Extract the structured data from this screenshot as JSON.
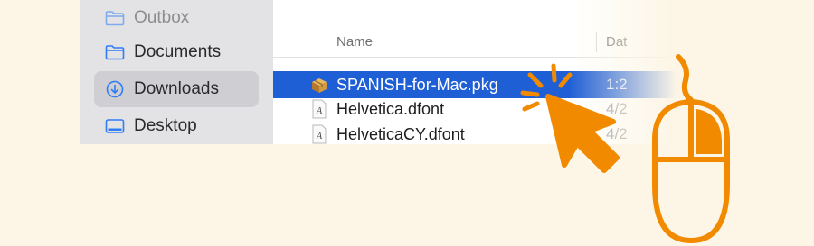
{
  "sidebar": {
    "items": [
      {
        "label": "Outbox",
        "icon": "folder-icon"
      },
      {
        "label": "Documents",
        "icon": "folder-icon"
      },
      {
        "label": "Downloads",
        "icon": "download-circle-icon",
        "active": true
      },
      {
        "label": "Desktop",
        "icon": "desktop-icon"
      }
    ]
  },
  "file_list": {
    "columns": {
      "name": "Name",
      "date": "Dat"
    },
    "rows": [
      {
        "name": "SPANISH-for-Mac.pkg",
        "date": "1:2",
        "icon": "package-icon",
        "selected": true
      },
      {
        "name": "Helvetica.dfont",
        "date": "4/2",
        "icon": "font-file-icon"
      },
      {
        "name": "HelveticaCY.dfont",
        "date": "4/2",
        "icon": "font-file-icon"
      }
    ]
  },
  "colors": {
    "background": "#fdf6e6",
    "accent": "#f28a00",
    "selection": "#1f5fd6",
    "folder": "#2f7cf6"
  }
}
